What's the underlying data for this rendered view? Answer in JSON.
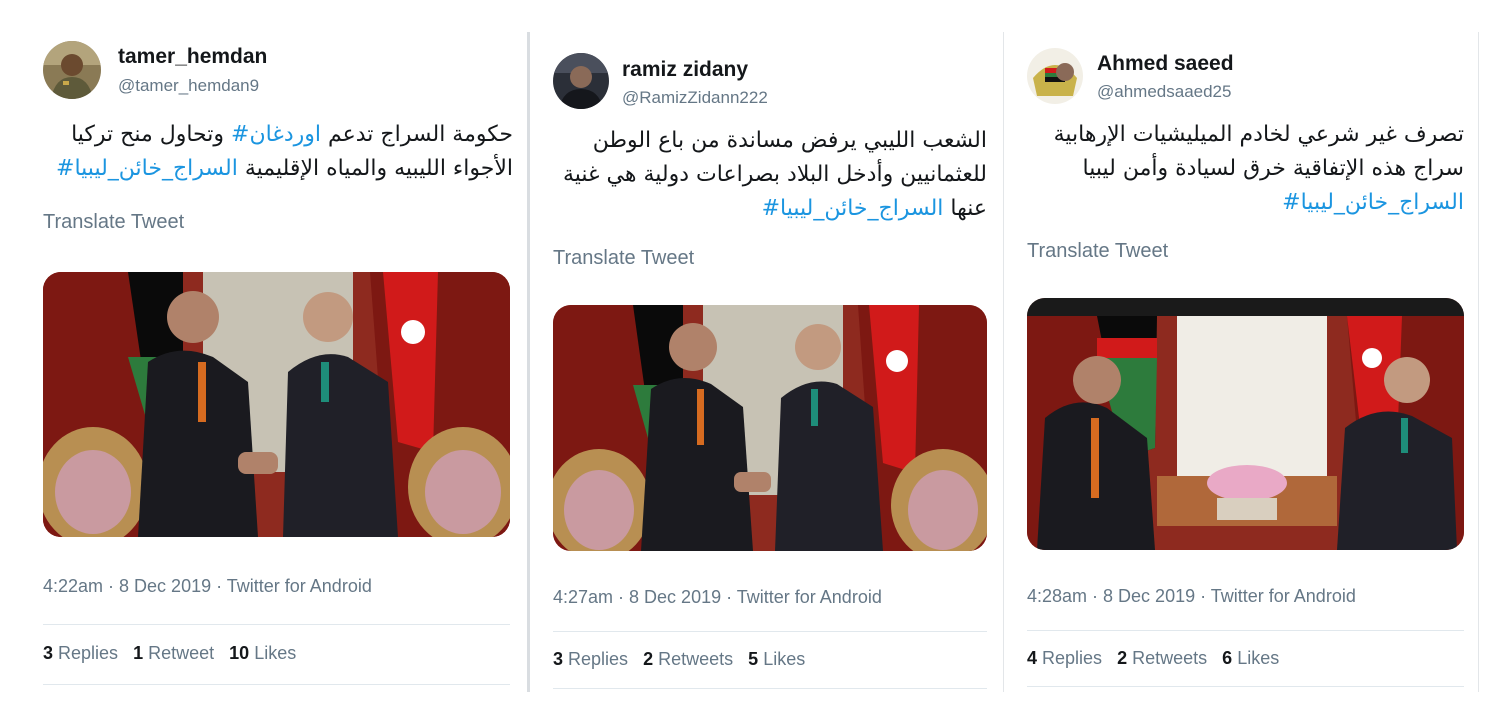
{
  "tweets": [
    {
      "name": "tamer_hemdan",
      "handle": "@tamer_hemdan9",
      "text_line1_a": "حكومة السراج تدعم ",
      "text_line1_tag": "اوردغان#",
      "text_line1_b": " وتحاول منح تركيا",
      "text_line2_a": "الأجواء الليبيه والمياه الإقليمية ",
      "text_line2_tag": "السراج_خائن_ليبيا#",
      "translate": "Translate Tweet",
      "meta": "4:22am · 8 Dec 2019 · Twitter for Android",
      "replies_count": "3",
      "replies_label": "Replies",
      "retweets_count": "1",
      "retweets_label": "Retweet",
      "likes_count": "10",
      "likes_label": "Likes"
    },
    {
      "name": "ramiz zidany",
      "handle": "@RamizZidann222",
      "text_line1": "الشعب الليبي يرفض مساندة من باع الوطن",
      "text_line2": "للعثمانيين وأدخل البلاد بصراعات دولية هي غنية",
      "text_line3_a": "عنها ",
      "text_line3_tag": "السراج_خائن_ليبيا#",
      "translate": "Translate Tweet",
      "meta": "4:27am · 8 Dec 2019 · Twitter for Android",
      "replies_count": "3",
      "replies_label": "Replies",
      "retweets_count": "2",
      "retweets_label": "Retweets",
      "likes_count": "5",
      "likes_label": "Likes"
    },
    {
      "name": "Ahmed saeed",
      "handle": "@ahmedsaaed25",
      "text_line1": "تصرف غير شرعي لخادم الميليشيات الإرهابية",
      "text_line2": "سراج هذه الإتفاقية خرق لسيادة وأمن ليبيا",
      "text_line3_tag": "السراج_خائن_ليبيا#",
      "translate": "Translate Tweet",
      "meta": "4:28am · 8 Dec 2019 · Twitter for Android",
      "replies_count": "4",
      "replies_label": "Replies",
      "retweets_count": "2",
      "retweets_label": "Retweets",
      "likes_count": "6",
      "likes_label": "Likes"
    }
  ],
  "colors": {
    "link": "#1b95e0",
    "secondary": "#657786",
    "primary": "#14171a",
    "rule": "#e1e8ed"
  }
}
